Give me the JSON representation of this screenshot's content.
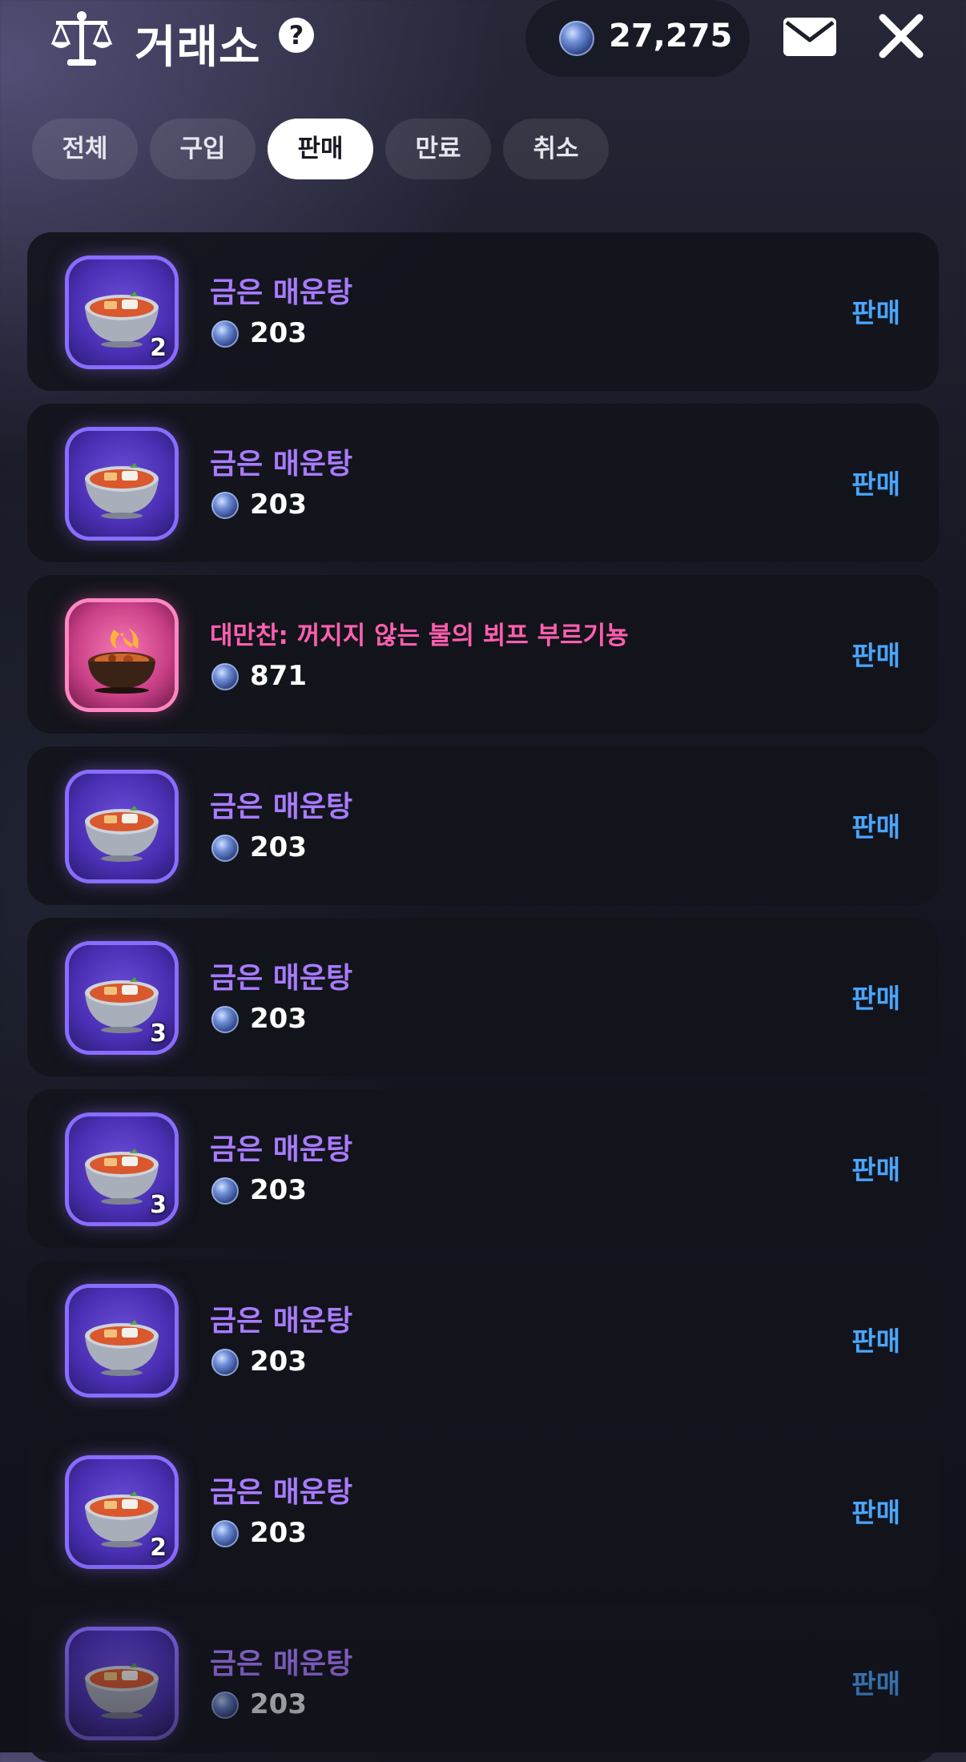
{
  "header": {
    "title": "거래소",
    "help_symbol": "?",
    "currency_amount": "27,275",
    "icons": [
      "scale-icon",
      "help-icon",
      "coin-icon",
      "mail-icon",
      "close-icon"
    ]
  },
  "tabs": [
    {
      "label": "전체",
      "active": false
    },
    {
      "label": "구입",
      "active": false
    },
    {
      "label": "판매",
      "active": true
    },
    {
      "label": "만료",
      "active": false
    },
    {
      "label": "취소",
      "active": false
    }
  ],
  "items": [
    {
      "name": "금은 매운탕",
      "price": "203",
      "qty": "2",
      "action": "판매",
      "rarity": "epic"
    },
    {
      "name": "금은 매운탕",
      "price": "203",
      "qty": "",
      "action": "판매",
      "rarity": "epic"
    },
    {
      "name": "대만찬: 꺼지지 않는 불의 뵈프 부르기뇽",
      "price": "871",
      "qty": "",
      "action": "판매",
      "rarity": "legend"
    },
    {
      "name": "금은 매운탕",
      "price": "203",
      "qty": "",
      "action": "판매",
      "rarity": "epic"
    },
    {
      "name": "금은 매운탕",
      "price": "203",
      "qty": "3",
      "action": "판매",
      "rarity": "epic"
    },
    {
      "name": "금은 매운탕",
      "price": "203",
      "qty": "3",
      "action": "판매",
      "rarity": "epic"
    },
    {
      "name": "금은 매운탕",
      "price": "203",
      "qty": "",
      "action": "판매",
      "rarity": "epic"
    },
    {
      "name": "금은 매운탕",
      "price": "203",
      "qty": "2",
      "action": "판매",
      "rarity": "epic"
    },
    {
      "name": "금은 매운탕",
      "price": "203",
      "qty": "",
      "action": "판매",
      "rarity": "epic"
    }
  ],
  "colors": {
    "epic": "#a87bff",
    "legend": "#ff5fae",
    "action": "#4aa6ff",
    "tab_active_bg": "#ffffff"
  }
}
